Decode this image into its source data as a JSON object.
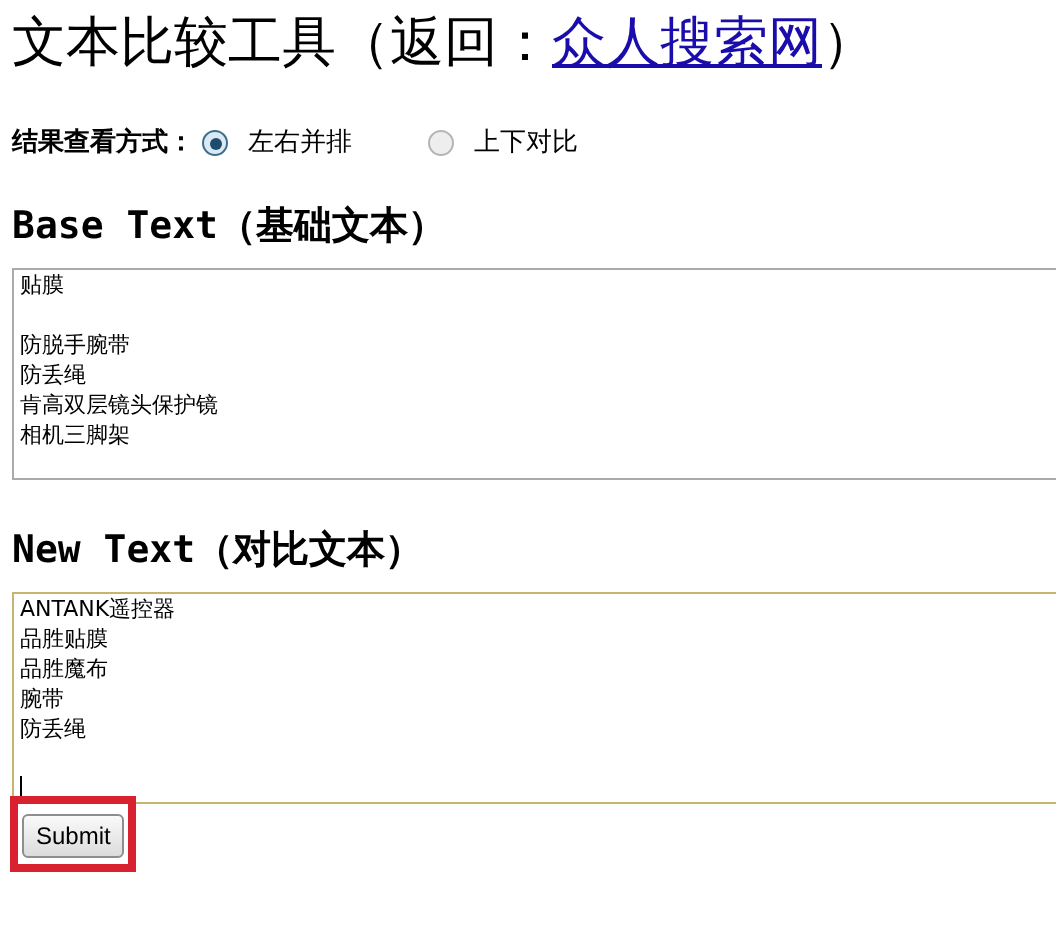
{
  "title": {
    "text": "文本比较工具（返回：",
    "link": "众人搜索网",
    "close": "）"
  },
  "view_mode": {
    "label": "结果查看方式：",
    "options": [
      {
        "label": "左右并排",
        "selected": true
      },
      {
        "label": "上下对比",
        "selected": false
      }
    ]
  },
  "base_text": {
    "heading": "Base Text（基础文本）",
    "lines": [
      {
        "text": "贴膜",
        "gap_before": false
      },
      {
        "text": "防脱手腕带",
        "gap_before": true
      },
      {
        "text": "防丢绳",
        "gap_before": false
      },
      {
        "text": "肯高双层镜头保护镜",
        "gap_before": false
      },
      {
        "text": "相机三脚架",
        "gap_before": false
      }
    ],
    "focused": false
  },
  "new_text": {
    "heading": "New Text（对比文本）",
    "lines": [
      {
        "text": "ANTANK遥控器",
        "gap_before": false
      },
      {
        "text": "品胜贴膜",
        "gap_before": false
      },
      {
        "text": "品胜魔布",
        "gap_before": false
      },
      {
        "text": "腕带",
        "gap_before": false
      },
      {
        "text": "防丢绳",
        "gap_before": false
      }
    ],
    "focused": true
  },
  "submit": {
    "label": "Submit",
    "highlighted": true
  }
}
